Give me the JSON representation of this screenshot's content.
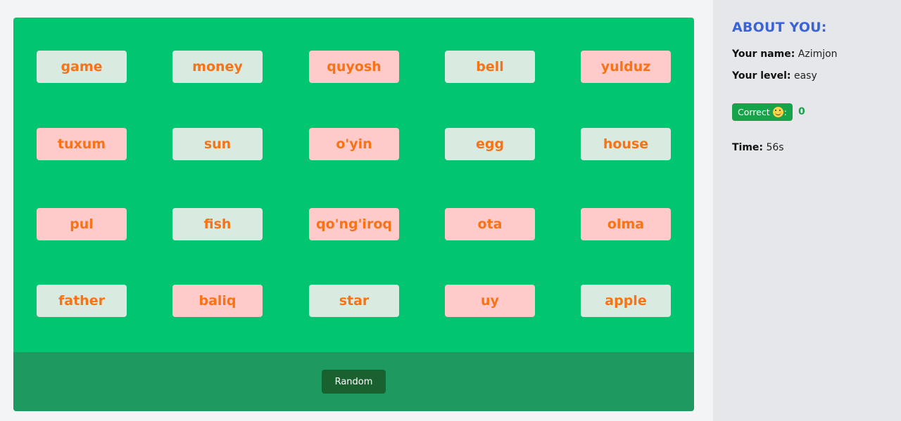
{
  "board": {
    "cards": [
      {
        "text": "game",
        "lang": "en"
      },
      {
        "text": "money",
        "lang": "en"
      },
      {
        "text": "quyosh",
        "lang": "uz"
      },
      {
        "text": "bell",
        "lang": "en"
      },
      {
        "text": "yulduz",
        "lang": "uz"
      },
      {
        "text": "tuxum",
        "lang": "uz"
      },
      {
        "text": "sun",
        "lang": "en"
      },
      {
        "text": "o'yin",
        "lang": "uz"
      },
      {
        "text": "egg",
        "lang": "en"
      },
      {
        "text": "house",
        "lang": "en"
      },
      {
        "text": "pul",
        "lang": "uz"
      },
      {
        "text": "fish",
        "lang": "en"
      },
      {
        "text": "qo'ng'iroq",
        "lang": "uz"
      },
      {
        "text": "ota",
        "lang": "uz"
      },
      {
        "text": "olma",
        "lang": "uz"
      },
      {
        "text": "father",
        "lang": "en"
      },
      {
        "text": "baliq",
        "lang": "uz"
      },
      {
        "text": "star",
        "lang": "en"
      },
      {
        "text": "uy",
        "lang": "uz"
      },
      {
        "text": "apple",
        "lang": "en"
      }
    ],
    "random_label": "Random"
  },
  "sidebar": {
    "title": "ABOUT YOU:",
    "name_label": "Your name:",
    "name_value": "Azimjon",
    "level_label": "Your level:",
    "level_value": "easy",
    "correct_label": "Correct",
    "correct_suffix": ":",
    "correct_icon": "smile-icon",
    "correct_count": "0",
    "time_label": "Time:",
    "time_value": "56s"
  },
  "colors": {
    "board_bg": "#02c571",
    "footer_bg": "#1e9960",
    "card_en_bg": "#d9ebe1",
    "card_uz_bg": "#fecaca",
    "card_text": "#f97316",
    "title_color": "#3b63d6",
    "correct_green": "#16a34a"
  }
}
